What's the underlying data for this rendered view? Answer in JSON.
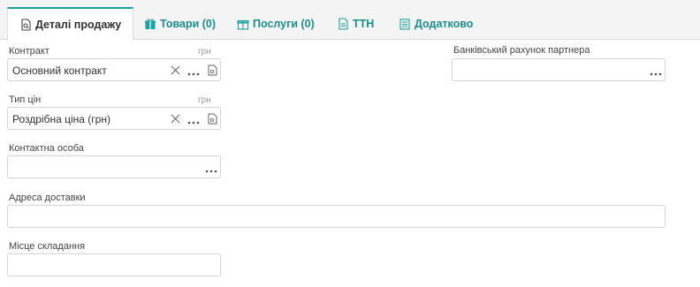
{
  "tabs": [
    {
      "label": "Деталі продажу",
      "icon": "document-search-icon",
      "active": true
    },
    {
      "label": "Товари (0)",
      "icon": "gift-icon",
      "active": false
    },
    {
      "label": "Послуги (0)",
      "icon": "gift-outline-icon",
      "active": false
    },
    {
      "label": "ТТН",
      "icon": "document-icon",
      "active": false
    },
    {
      "label": "Додатково",
      "icon": "notes-icon",
      "active": false
    }
  ],
  "form": {
    "contract": {
      "label": "Контракт",
      "unit": "грн",
      "value": "Основний контракт"
    },
    "price_type": {
      "label": "Тип цін",
      "unit": "грн",
      "value": "Роздрібна ціна (грн)"
    },
    "contact_person": {
      "label": "Контактна особа",
      "value": ""
    },
    "delivery_address": {
      "label": "Адреса доставки",
      "value": ""
    },
    "place_of_compilation": {
      "label": "Місце складання",
      "value": ""
    },
    "bank_account": {
      "label": "Банківський рахунок партнера",
      "value": ""
    }
  },
  "colors": {
    "accent": "#1e9e9e",
    "tab_text": "#1e8c8c",
    "border": "#d4d4d4"
  }
}
